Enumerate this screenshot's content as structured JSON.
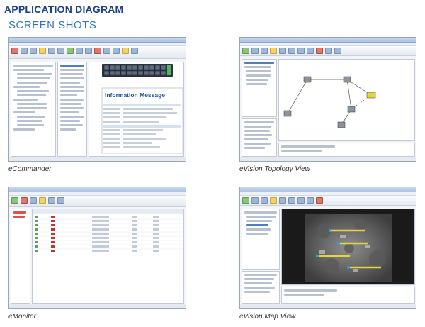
{
  "header": {
    "title": "APPLICATION DIAGRAM",
    "subtitle": "SCREEN SHOTS"
  },
  "screens": [
    {
      "caption": "eCommander",
      "message_title": "Information Message"
    },
    {
      "caption": "eVision Topology View"
    },
    {
      "caption": "eMonitor"
    },
    {
      "caption": "eVision Map View"
    }
  ],
  "colors": {
    "title": "#1e3f8c",
    "subtitle": "#2f73c4",
    "switch_port": "#2a3340",
    "port_led": "#4fb85a"
  }
}
